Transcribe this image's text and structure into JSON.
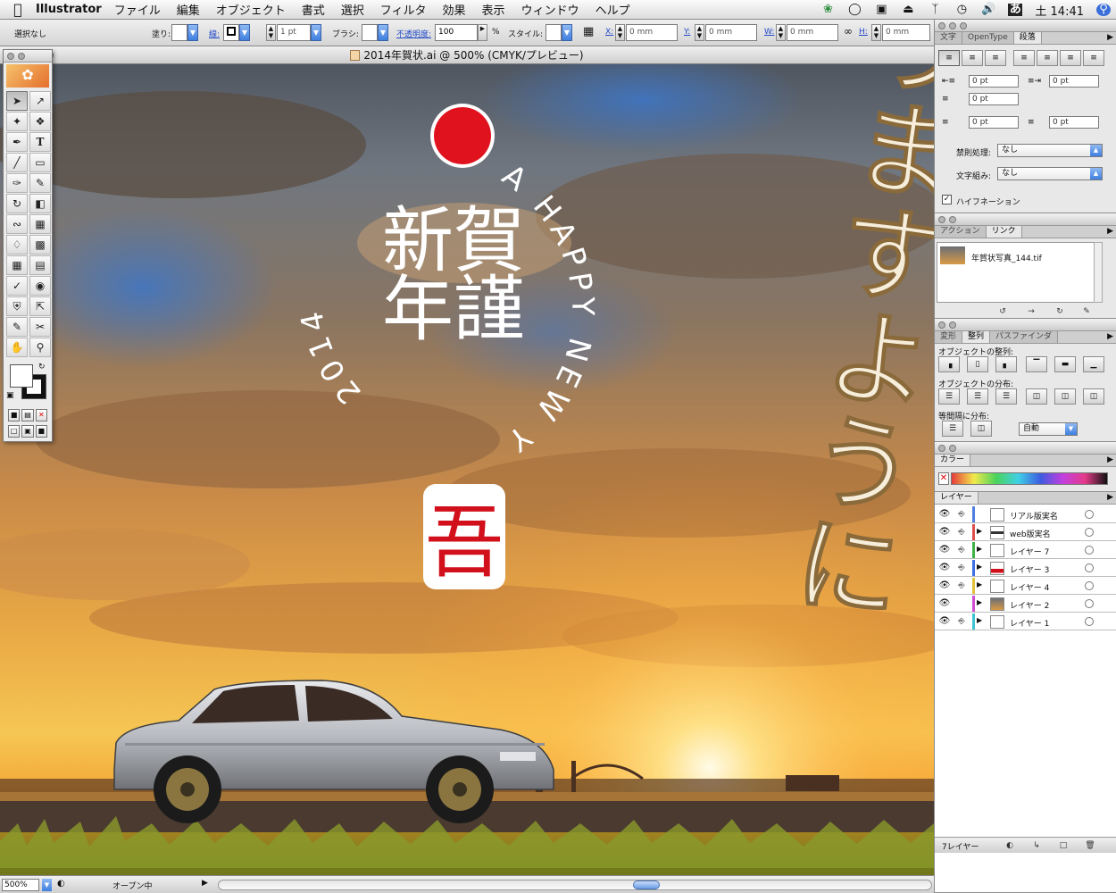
{
  "menubar": {
    "app": "Illustrator",
    "items": [
      "ファイル",
      "編集",
      "オブジェクト",
      "書式",
      "選択",
      "フィルタ",
      "効果",
      "表示",
      "ウィンドウ",
      "ヘルプ"
    ],
    "clock": "土 14:41"
  },
  "controlbar": {
    "selection": "選択なし",
    "fill_label": "塗り:",
    "stroke_label": "線:",
    "stroke_weight": "1 pt",
    "brush_label": "ブラシ:",
    "opacity_label": "不透明度:",
    "opacity_value": "100",
    "percent": "%",
    "style_label": "スタイル:",
    "x_label": "X:",
    "x_value": "0 mm",
    "y_label": "Y:",
    "y_value": "0 mm",
    "w_label": "W:",
    "w_value": "0 mm",
    "h_label": "H:",
    "h_value": "0 mm"
  },
  "document": {
    "title": "2014年賀状.ai @ 500% (CMYK/プレビュー)"
  },
  "artwork": {
    "kanji_line1": "新賀",
    "kanji_line2": "年謹",
    "year": "2014",
    "greeting": "A HAPPY NEW YEAR!!",
    "seal": "吾",
    "calligraphy": "なりますように",
    "sun_color": "#e0121e"
  },
  "statusbar": {
    "zoom": "500%",
    "status": "オープン中"
  },
  "paragraph_panel": {
    "tabs": [
      "文字",
      "OpenType",
      "段落"
    ],
    "left_indent": "0 pt",
    "right_indent": "0 pt",
    "first_line_indent": "0 pt",
    "space_before": "0 pt",
    "space_after": "0 pt",
    "kinsoku_label": "禁則処理:",
    "kinsoku_value": "なし",
    "mojikumi_label": "文字組み:",
    "mojikumi_value": "なし",
    "hyphenation_label": "ハイフネーション"
  },
  "links_panel": {
    "tabs": [
      "アクション",
      "リンク"
    ],
    "items": [
      {
        "name": "年賀状写真_144.tif"
      }
    ]
  },
  "align_panel": {
    "tabs": [
      "変形",
      "整列",
      "パスファインダ"
    ],
    "align_objects_label": "オブジェクトの整列:",
    "distribute_objects_label": "オブジェクトの分布:",
    "distribute_spacing_label": "等間隔に分布:",
    "spacing_value": "自動"
  },
  "color_panel": {
    "tab": "カラー"
  },
  "layers_panel": {
    "tab": "レイヤー",
    "layers": [
      {
        "name": "リアル版実名",
        "color": "#4f7fe0",
        "expandable": false
      },
      {
        "name": "web版実名",
        "color": "#e04f4f",
        "expandable": true
      },
      {
        "name": "レイヤー 7",
        "color": "#3fb24a",
        "expandable": true
      },
      {
        "name": "レイヤー 3",
        "color": "#3f6fe0",
        "expandable": true
      },
      {
        "name": "レイヤー 4",
        "color": "#e0c23f",
        "expandable": true
      },
      {
        "name": "レイヤー 2",
        "color": "#d04fd0",
        "expandable": true
      },
      {
        "name": "レイヤー 1",
        "color": "#3fc4d4",
        "expandable": true
      }
    ],
    "count": "7レイヤー"
  }
}
